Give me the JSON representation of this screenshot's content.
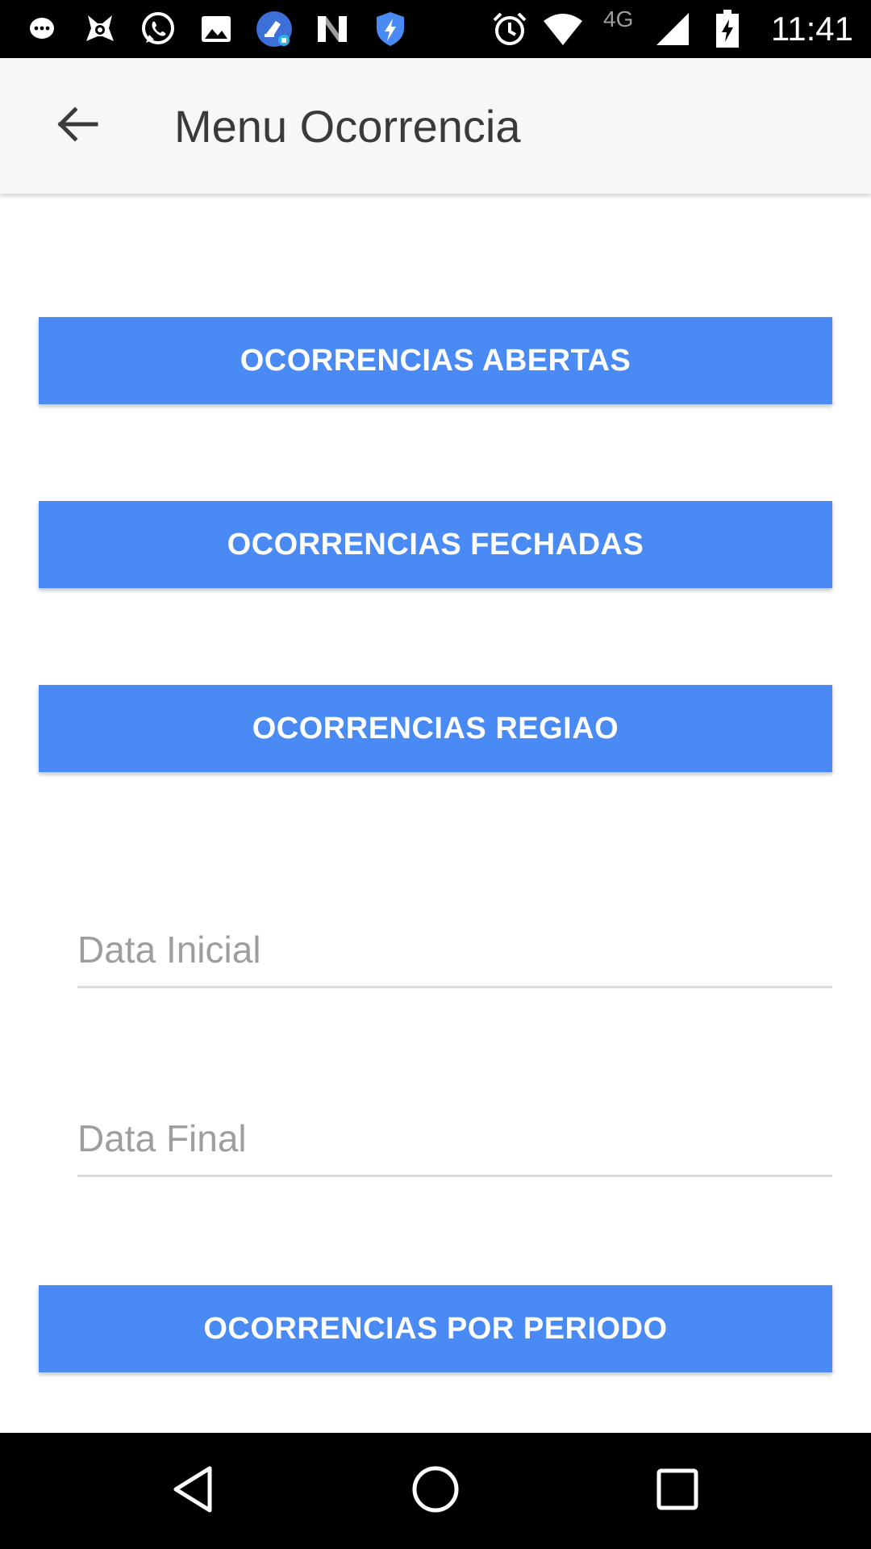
{
  "status_bar": {
    "time": "11:41",
    "network_label": "4G",
    "icons": [
      "messaging-icon",
      "bitmoji-icon",
      "whatsapp-icon",
      "gallery-icon",
      "cleaner-icon",
      "n-app-icon",
      "shield-icon",
      "alarm-icon",
      "wifi-icon",
      "signal-icon",
      "battery-charging-icon"
    ]
  },
  "app_bar": {
    "title": "Menu Ocorrencia",
    "back_icon": "arrow-back-icon"
  },
  "buttons": {
    "abertas": "OCORRENCIAS ABERTAS",
    "fechadas": "OCORRENCIAS FECHADAS",
    "regiao": "OCORRENCIAS REGIAO",
    "por_periodo": "OCORRENCIAS POR PERIODO"
  },
  "fields": {
    "data_inicial": {
      "placeholder": "Data Inicial",
      "value": ""
    },
    "data_final": {
      "placeholder": "Data Final",
      "value": ""
    }
  },
  "nav_bar": {
    "icons": [
      "back-triangle-icon",
      "home-circle-icon",
      "recents-square-icon"
    ]
  },
  "colors": {
    "accent": "#4a8af4",
    "app_bar_bg": "#f7f7f7",
    "status_bar_bg": "#000000",
    "title_text": "#3a3a3a",
    "placeholder": "#9e9e9e"
  }
}
